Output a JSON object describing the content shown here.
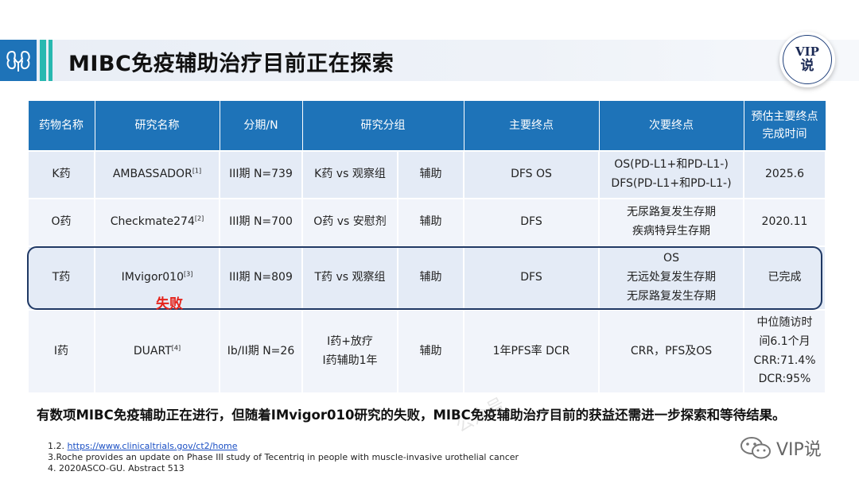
{
  "header": {
    "title": "MIBC免疫辅助治疗目前正在探索",
    "vip_badge": {
      "line1": "VIP",
      "line2": "说"
    }
  },
  "table": {
    "columns": [
      "药物名称",
      "研究名称",
      "分期/N",
      "研究分组",
      "主要终点",
      "次要终点",
      "预估主要终点完成时间"
    ],
    "rows": [
      {
        "drug": "K药",
        "study": "AMBASSADOR",
        "ref": "[1]",
        "stage": "III期 N=739",
        "group": "K药 vs 观察组",
        "setting": "辅助",
        "primary": "DFS OS",
        "secondary": [
          "OS(PD-L1+和PD-L1-)",
          "DFS(PD-L1+和PD-L1-)"
        ],
        "completion": [
          "2025.6"
        ]
      },
      {
        "drug": "O药",
        "study": "Checkmate274",
        "ref": "[2]",
        "stage": "III期 N=700",
        "group": "O药 vs 安慰剂",
        "setting": "辅助",
        "primary": "DFS",
        "secondary": [
          "无尿路复发生存期",
          "疾病特异生存期"
        ],
        "completion": [
          "2020.11"
        ]
      },
      {
        "drug": "T药",
        "study": "IMvigor010",
        "ref": "[3]",
        "status": "失败",
        "stage": "III期 N=809",
        "group": "T药 vs 观察组",
        "setting": "辅助",
        "primary": "DFS",
        "secondary": [
          "OS",
          "无远处复发生存期",
          "无尿路复发生存期"
        ],
        "completion": [
          "已完成"
        ]
      },
      {
        "drug": "I药",
        "study": "DUART",
        "ref": "[4]",
        "stage": "Ib/II期 N=26",
        "group": [
          "I药+放疗",
          "I药辅助1年"
        ],
        "setting": "辅助",
        "primary": "1年PFS率 DCR",
        "secondary": [
          "CRR，PFS及OS"
        ],
        "completion": [
          "中位随访时",
          "间6.1个月",
          "CRR:71.4%",
          "DCR:95%"
        ]
      }
    ]
  },
  "conclusion": "有数项MIBC免疫辅助正在进行，但随着IMvigor010研究的失败，MIBC免疫辅助治疗目前的获益还需进一步探索和等待结果。",
  "watermark": "公众号",
  "references": {
    "r1_prefix": "1.2. ",
    "r1_link": "https://www.clinicaltrials.gov/ct2/home",
    "r2": "3.Roche provides an update on Phase III study of Tecentriq in people with muscle-invasive urothelial cancer",
    "r3": "4. 2020ASCO-GU. Abstract 513"
  },
  "brand": {
    "label": "VIP说",
    "icon": "wechat-icon"
  },
  "colors": {
    "header_blue": "#1e73b8",
    "accent_teal": "#28b8b0",
    "fail_red": "#e5231b",
    "box_navy": "#1f3864"
  }
}
